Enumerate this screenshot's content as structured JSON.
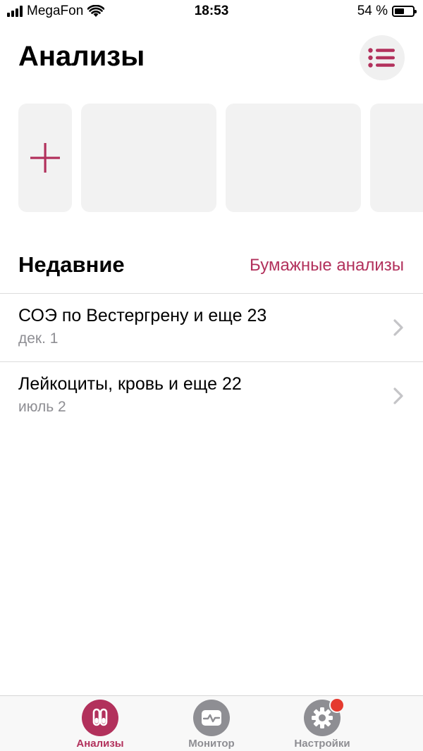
{
  "status_bar": {
    "carrier": "MegaFon",
    "time": "18:53",
    "battery_percent": "54 %",
    "battery_level": 0.54
  },
  "header": {
    "title": "Анализы",
    "menu_icon": "list-icon"
  },
  "cards": {
    "add_icon": "plus-icon"
  },
  "recent": {
    "title": "Недавние",
    "paper_link": "Бумажные анализы",
    "items": [
      {
        "title": "СОЭ по Вестергрену и еще 23",
        "date": "дек. 1"
      },
      {
        "title": "Лейкоциты, кровь и еще 22",
        "date": "июль 2"
      }
    ]
  },
  "tab_bar": {
    "tabs": [
      {
        "label": "Анализы",
        "icon": "test-tubes-icon",
        "active": true
      },
      {
        "label": "Монитор",
        "icon": "monitor-pulse-icon",
        "active": false
      },
      {
        "label": "Настройки",
        "icon": "gear-icon",
        "active": false,
        "badge": true
      }
    ]
  },
  "colors": {
    "accent": "#b2315c",
    "inactive": "#8e8e93",
    "card_bg": "#f2f2f2",
    "badge": "#e53a2f"
  }
}
